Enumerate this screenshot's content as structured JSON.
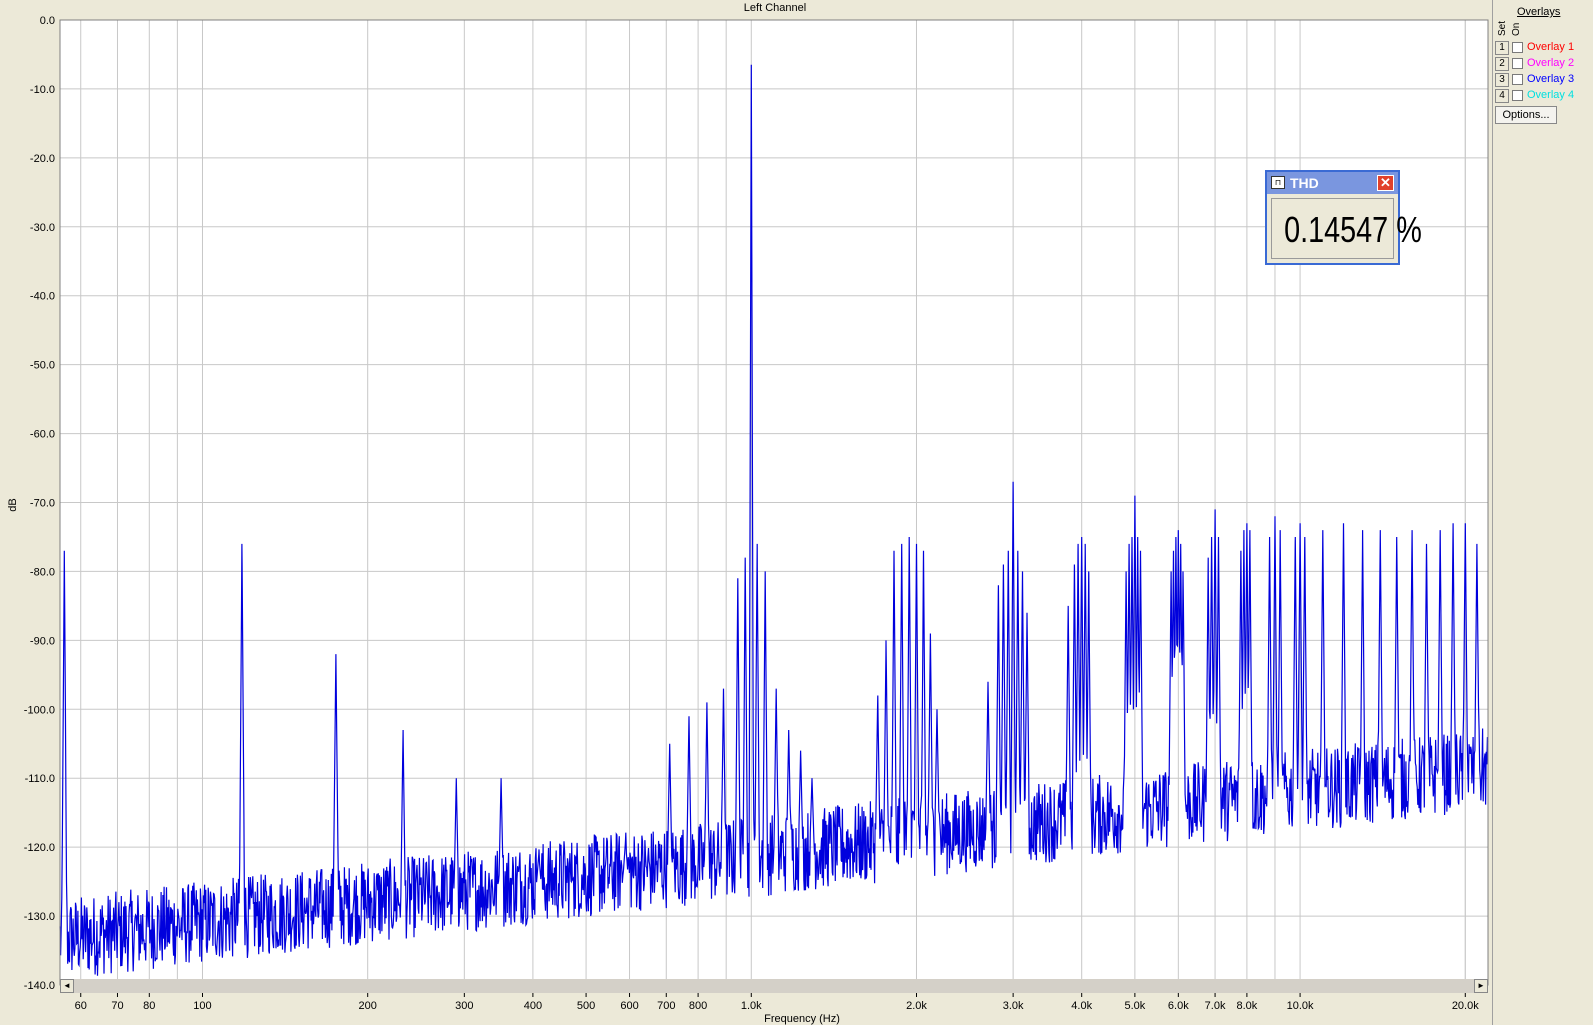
{
  "colors": {
    "background": "#ece9d8",
    "plot_background": "#ffffff",
    "grid": "#c8c8c8",
    "trace": "#0000dd",
    "overlay_1": "#ff0000",
    "overlay_2": "#ff00ff",
    "overlay_3": "#0000ff",
    "overlay_4": "#00e0e0",
    "titlebar": "#7a96df"
  },
  "overlays": {
    "title": "Overlays",
    "set_label": "Set",
    "on_label": "On",
    "items": [
      {
        "num": "1",
        "label": "Overlay 1",
        "color": "#ff0000",
        "checked": false
      },
      {
        "num": "2",
        "label": "Overlay 2",
        "color": "#ff00ff",
        "checked": false
      },
      {
        "num": "3",
        "label": "Overlay 3",
        "color": "#0000ff",
        "checked": false
      },
      {
        "num": "4",
        "label": "Overlay 4",
        "color": "#00e0e0",
        "checked": false
      }
    ],
    "options_label": "Options..."
  },
  "thd_window": {
    "title": "THD",
    "close_icon": "close-icon",
    "value": "0.14547 %"
  },
  "scrollbar": {
    "left_arrow": "◄",
    "right_arrow": "►"
  },
  "chart_data": {
    "type": "line",
    "title": "Left Channel",
    "xlabel": "Frequency (Hz)",
    "ylabel": "dB",
    "xscale": "log",
    "xlim": [
      55,
      22000
    ],
    "ylim": [
      -140,
      0
    ],
    "grid": true,
    "y_ticks": [
      "0.0",
      "-10.0",
      "-20.0",
      "-30.0",
      "-40.0",
      "-50.0",
      "-60.0",
      "-70.0",
      "-80.0",
      "-90.0",
      "-100.0",
      "-110.0",
      "-120.0",
      "-130.0",
      "-140.0"
    ],
    "x_ticks": [
      {
        "f": 60,
        "label": "60"
      },
      {
        "f": 70,
        "label": "70"
      },
      {
        "f": 80,
        "label": "80"
      },
      {
        "f": 100,
        "label": "100"
      },
      {
        "f": 200,
        "label": "200"
      },
      {
        "f": 300,
        "label": "300"
      },
      {
        "f": 400,
        "label": "400"
      },
      {
        "f": 500,
        "label": "500"
      },
      {
        "f": 600,
        "label": "600"
      },
      {
        "f": 700,
        "label": "700"
      },
      {
        "f": 800,
        "label": "800"
      },
      {
        "f": 1000,
        "label": "1.0k"
      },
      {
        "f": 2000,
        "label": "2.0k"
      },
      {
        "f": 3000,
        "label": "3.0k"
      },
      {
        "f": 4000,
        "label": "4.0k"
      },
      {
        "f": 5000,
        "label": "5.0k"
      },
      {
        "f": 6000,
        "label": "6.0k"
      },
      {
        "f": 7000,
        "label": "7.0k"
      },
      {
        "f": 8000,
        "label": "8.0k"
      },
      {
        "f": 10000,
        "label": "10.0k"
      },
      {
        "f": 20000,
        "label": "20.0k"
      }
    ],
    "series": [
      {
        "peaks": [
          {
            "f": 56,
            "db": -77
          },
          {
            "f": 118,
            "db": -76
          },
          {
            "f": 175,
            "db": -92
          },
          {
            "f": 232,
            "db": -103
          },
          {
            "f": 290,
            "db": -110
          },
          {
            "f": 350,
            "db": -110
          },
          {
            "f": 410,
            "db": -121
          },
          {
            "f": 470,
            "db": -125
          },
          {
            "f": 590,
            "db": -119
          },
          {
            "f": 710,
            "db": -105
          },
          {
            "f": 770,
            "db": -101
          },
          {
            "f": 830,
            "db": -99
          },
          {
            "f": 890,
            "db": -97
          },
          {
            "f": 945,
            "db": -81
          },
          {
            "f": 975,
            "db": -78
          },
          {
            "f": 1000,
            "db": -6.5
          },
          {
            "f": 1025,
            "db": -76
          },
          {
            "f": 1060,
            "db": -80
          },
          {
            "f": 1110,
            "db": -97
          },
          {
            "f": 1170,
            "db": -103
          },
          {
            "f": 1230,
            "db": -106
          },
          {
            "f": 1290,
            "db": -110
          },
          {
            "f": 1700,
            "db": -98
          },
          {
            "f": 1760,
            "db": -90
          },
          {
            "f": 1820,
            "db": -77
          },
          {
            "f": 1880,
            "db": -76
          },
          {
            "f": 1940,
            "db": -75
          },
          {
            "f": 2000,
            "db": -76
          },
          {
            "f": 2060,
            "db": -77
          },
          {
            "f": 2120,
            "db": -89
          },
          {
            "f": 2180,
            "db": -100
          },
          {
            "f": 2700,
            "db": -96
          },
          {
            "f": 2820,
            "db": -82
          },
          {
            "f": 2880,
            "db": -79
          },
          {
            "f": 2940,
            "db": -77
          },
          {
            "f": 3000,
            "db": -67
          },
          {
            "f": 3060,
            "db": -77
          },
          {
            "f": 3120,
            "db": -80
          },
          {
            "f": 3180,
            "db": -86
          },
          {
            "f": 3780,
            "db": -85
          },
          {
            "f": 3880,
            "db": -79
          },
          {
            "f": 3940,
            "db": -76
          },
          {
            "f": 4000,
            "db": -75
          },
          {
            "f": 4060,
            "db": -76
          },
          {
            "f": 4120,
            "db": -80
          },
          {
            "f": 4820,
            "db": -80
          },
          {
            "f": 4880,
            "db": -76
          },
          {
            "f": 4940,
            "db": -75
          },
          {
            "f": 5000,
            "db": -69
          },
          {
            "f": 5060,
            "db": -75
          },
          {
            "f": 5120,
            "db": -77
          },
          {
            "f": 5820,
            "db": -80
          },
          {
            "f": 5880,
            "db": -77
          },
          {
            "f": 5940,
            "db": -75
          },
          {
            "f": 6000,
            "db": -74
          },
          {
            "f": 6060,
            "db": -76
          },
          {
            "f": 6120,
            "db": -80
          },
          {
            "f": 6800,
            "db": -78
          },
          {
            "f": 6900,
            "db": -75
          },
          {
            "f": 7000,
            "db": -71
          },
          {
            "f": 7100,
            "db": -75
          },
          {
            "f": 7800,
            "db": -77
          },
          {
            "f": 7900,
            "db": -74
          },
          {
            "f": 8000,
            "db": -73
          },
          {
            "f": 8100,
            "db": -74
          },
          {
            "f": 8800,
            "db": -75
          },
          {
            "f": 9000,
            "db": -72
          },
          {
            "f": 9200,
            "db": -74
          },
          {
            "f": 9800,
            "db": -75
          },
          {
            "f": 10000,
            "db": -73
          },
          {
            "f": 10200,
            "db": -75
          },
          {
            "f": 11000,
            "db": -74
          },
          {
            "f": 12000,
            "db": -73
          },
          {
            "f": 13000,
            "db": -74
          },
          {
            "f": 14000,
            "db": -74
          },
          {
            "f": 15000,
            "db": -75
          },
          {
            "f": 16000,
            "db": -74
          },
          {
            "f": 17000,
            "db": -76
          },
          {
            "f": 18000,
            "db": -74
          },
          {
            "f": 19000,
            "db": -73
          },
          {
            "f": 20000,
            "db": -73
          },
          {
            "f": 21000,
            "db": -76
          }
        ]
      }
    ]
  }
}
